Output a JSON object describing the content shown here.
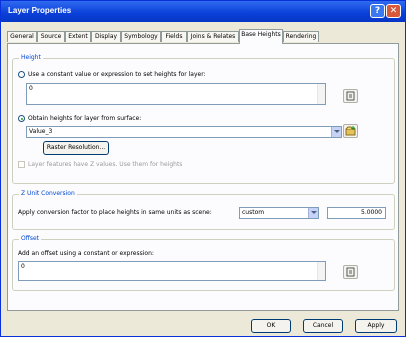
{
  "window": {
    "title": "Layer Properties",
    "help_glyph": "?",
    "close_glyph": "✕"
  },
  "tabs": [
    {
      "label": "General"
    },
    {
      "label": "Source"
    },
    {
      "label": "Extent"
    },
    {
      "label": "Display"
    },
    {
      "label": "Symbology"
    },
    {
      "label": "Fields"
    },
    {
      "label": "Joins & Relates"
    },
    {
      "label": "Base Heights"
    },
    {
      "label": "Rendering"
    }
  ],
  "active_tab": "Base Heights",
  "height_group": {
    "title": "Height",
    "option_constant": "Use a constant value or expression to set heights for layer:",
    "constant_value": "0",
    "option_surface": "Obtain heights for layer from surface:",
    "surface_value": "Value_3",
    "raster_resolution_button": "Raster Resolution...",
    "option_layer_values": "Layer features have Z values. Use them for heights"
  },
  "z_unit": {
    "title": "Z Unit Conversion",
    "label": "Apply conversion factor to place heights in same units as scene:",
    "unit_value": "custom",
    "factor_value": "5.0000"
  },
  "offset": {
    "title": "Offset",
    "label": "Add an offset using a constant or expression:",
    "value": "0"
  },
  "buttons": {
    "ok": "OK",
    "cancel": "Cancel",
    "apply": "Apply"
  }
}
